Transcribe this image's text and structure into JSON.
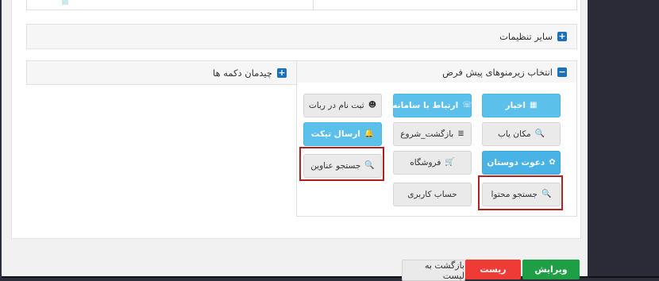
{
  "panels": {
    "other_settings": {
      "title": "سایر تنظیمات",
      "icon": "plus-square-icon"
    },
    "default_submenus": {
      "title": "انتخاب زیرمنوهای پیش فرض",
      "icon": "minus-square-icon"
    },
    "button_layout": {
      "title": "چیدمان دکمه ها",
      "icon": "plus-square-icon"
    }
  },
  "submenu_buttons": [
    {
      "label": "اخبار",
      "icon": "table-icon",
      "glyph": "▦",
      "style": "blue"
    },
    {
      "label": "ارتباط با سامانه",
      "icon": "phone-icon",
      "glyph": "☏",
      "style": "blue"
    },
    {
      "label": "ثبت نام در ربات",
      "icon": "user-secret-icon",
      "glyph": "☻",
      "style": "gray"
    },
    {
      "label": "مکان یاب",
      "icon": "search-icon",
      "glyph": "🔍",
      "style": "gray"
    },
    {
      "label": "بازگشت_شروع",
      "icon": "list-icon",
      "glyph": "≣",
      "style": "gray"
    },
    {
      "label": "ارسال تیکت",
      "icon": "bell-icon",
      "glyph": "🔔",
      "style": "blue"
    },
    {
      "label": "دعوت دوستان",
      "icon": "gift-icon",
      "glyph": "✿",
      "style": "blue2"
    },
    {
      "label": "فروشگاه",
      "icon": "cart-icon",
      "glyph": "🛒",
      "style": "gray"
    },
    {
      "label": "جستجو عناوین",
      "icon": "search-icon",
      "glyph": "🔍",
      "style": "gray"
    },
    {
      "label": "جستجو محتوا",
      "icon": "search-icon",
      "glyph": "🔍",
      "style": "gray"
    },
    {
      "label": "حساب کاربری",
      "icon": "",
      "glyph": "",
      "style": "gray"
    }
  ],
  "footer": {
    "edit_label": "ویرایش",
    "reset_label": "ریست",
    "back_label": "بازگشت به لیست"
  },
  "colors": {
    "primary_blue": "#1b72b8",
    "button_blue": "#5bc0ea",
    "edit_green": "#1e9e45",
    "reset_red": "#ef3b36",
    "highlight_red": "#b32020"
  }
}
